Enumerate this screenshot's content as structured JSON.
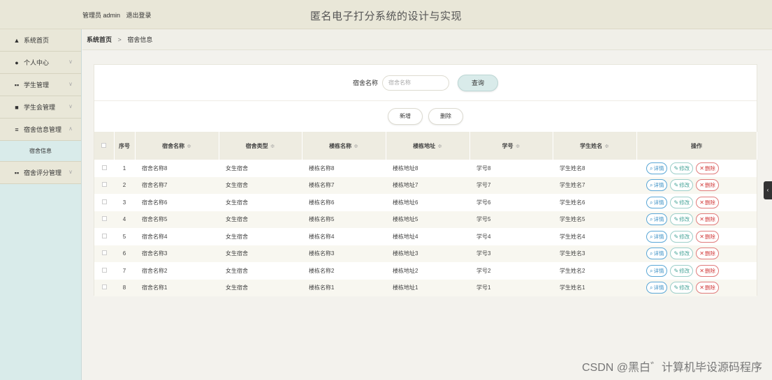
{
  "header": {
    "user_label": "管理员 admin",
    "logout": "退出登录",
    "title": "匿名电子打分系统的设计与实现"
  },
  "sidebar": {
    "items": [
      {
        "label": "系统首页",
        "icon": "home-icon"
      },
      {
        "label": "个人中心",
        "icon": "user-icon"
      },
      {
        "label": "学生管理",
        "icon": "grid-icon"
      },
      {
        "label": "学生会管理",
        "icon": "file-icon"
      },
      {
        "label": "宿舍信息管理",
        "icon": "list-icon"
      },
      {
        "label": "宿舍信息",
        "icon": ""
      },
      {
        "label": "宿舍评分管理",
        "icon": "grid-icon"
      }
    ]
  },
  "breadcrumb": {
    "home": "系统首页",
    "separator": ">",
    "current": "宿舍信息"
  },
  "search": {
    "label": "宿舍名称",
    "placeholder": "宿舍名称",
    "button": "查询"
  },
  "actions": {
    "add": "新增",
    "delete": "删除"
  },
  "table": {
    "headers": {
      "no": "序号",
      "name": "宿舍名称",
      "type": "宿舍类型",
      "building_name": "楼栋名称",
      "building_addr": "楼栋地址",
      "student_no": "学号",
      "student_name": "学生姓名",
      "ops": "操作"
    },
    "sort_glyph": "≑",
    "op_labels": {
      "detail": "详情",
      "edit": "修改",
      "delete": "删除"
    },
    "rows": [
      {
        "no": "1",
        "name": "宿舍名称8",
        "type": "女生宿舍",
        "building_name": "楼栋名称8",
        "building_addr": "楼栋地址8",
        "student_no": "学号8",
        "student_name": "学生姓名8"
      },
      {
        "no": "2",
        "name": "宿舍名称7",
        "type": "女生宿舍",
        "building_name": "楼栋名称7",
        "building_addr": "楼栋地址7",
        "student_no": "学号7",
        "student_name": "学生姓名7"
      },
      {
        "no": "3",
        "name": "宿舍名称6",
        "type": "女生宿舍",
        "building_name": "楼栋名称6",
        "building_addr": "楼栋地址6",
        "student_no": "学号6",
        "student_name": "学生姓名6"
      },
      {
        "no": "4",
        "name": "宿舍名称5",
        "type": "女生宿舍",
        "building_name": "楼栋名称5",
        "building_addr": "楼栋地址5",
        "student_no": "学号5",
        "student_name": "学生姓名5"
      },
      {
        "no": "5",
        "name": "宿舍名称4",
        "type": "女生宿舍",
        "building_name": "楼栋名称4",
        "building_addr": "楼栋地址4",
        "student_no": "学号4",
        "student_name": "学生姓名4"
      },
      {
        "no": "6",
        "name": "宿舍名称3",
        "type": "女生宿舍",
        "building_name": "楼栋名称3",
        "building_addr": "楼栋地址3",
        "student_no": "学号3",
        "student_name": "学生姓名3"
      },
      {
        "no": "7",
        "name": "宿舍名称2",
        "type": "女生宿舍",
        "building_name": "楼栋名称2",
        "building_addr": "楼栋地址2",
        "student_no": "学号2",
        "student_name": "学生姓名2"
      },
      {
        "no": "8",
        "name": "宿舍名称1",
        "type": "女生宿舍",
        "building_name": "楼栋名称1",
        "building_addr": "楼栋地址1",
        "student_no": "学号1",
        "student_name": "学生姓名1"
      }
    ]
  },
  "watermark": "CSDN @黑白゛计算机毕设源码程序",
  "colors": {
    "header_bg": "#e9e7d8",
    "sidebar_bg": "#d9ebea",
    "detail": "#3a8fc4",
    "edit": "#4aa59a",
    "delete": "#d23c3c"
  }
}
